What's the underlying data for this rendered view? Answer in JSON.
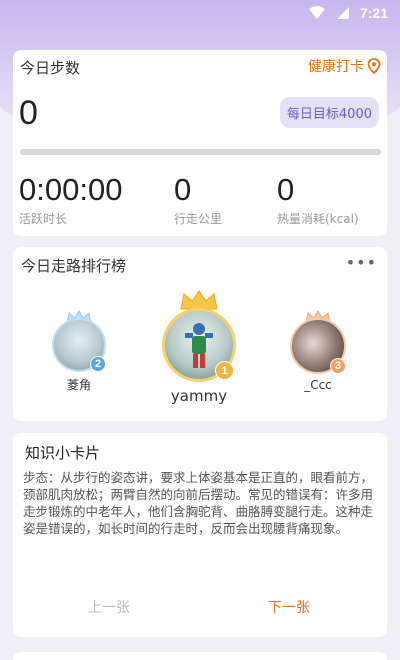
{
  "status_bar": {
    "time": "7:21"
  },
  "today_steps": {
    "title": "今日步数",
    "checkin_label": "健康打卡",
    "steps": "0",
    "daily_goal": "每日目标4000",
    "progress_fraction": 0,
    "stats": [
      {
        "value": "0:00:00",
        "label": "活跃时长"
      },
      {
        "value": "0",
        "label": "行走公里"
      },
      {
        "value": "0",
        "label": "热量消耗(kcal)"
      }
    ]
  },
  "leaderboard": {
    "title": "今日走路排行榜",
    "more_icon": "more-dots-icon",
    "ranks": [
      {
        "rank": "1",
        "name": "yammy",
        "color": "#f0b544"
      },
      {
        "rank": "2",
        "name": "菱角",
        "color": "#59a6e6"
      },
      {
        "rank": "3",
        "name": "_Ccc",
        "color": "#f0a062"
      }
    ]
  },
  "knowledge_card": {
    "title": "知识小卡片",
    "body": "步态：从步行的姿态讲，要求上体姿基本是正直的，眼看前方，颈部肌肉放松；两臂自然的向前后摆动。常见的错误有：许多用走步锻炼的中老年人，他们含胸驼背、曲胳膊变腿行走。这种走姿是错误的，如长时间的行走时，反而会出现腰背痛现象。",
    "prev_label": "上一张",
    "next_label": "下一张"
  },
  "colors": {
    "accent_orange": "#e5711b",
    "accent_purple": "#8f7ee0"
  }
}
